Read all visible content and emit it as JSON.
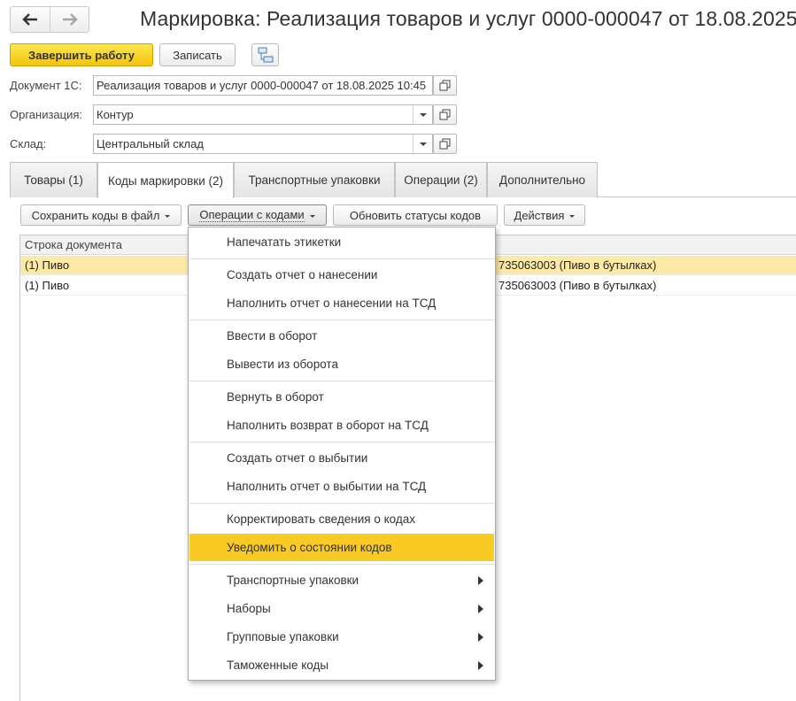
{
  "window": {
    "title": "Маркировка: Реализация товаров и услуг 0000-000047 от 18.08.2025"
  },
  "toolbar": {
    "finish_label": "Завершить работу",
    "save_label": "Записать"
  },
  "form": {
    "document_label": "Документ 1С:",
    "document_value": "Реализация товаров и услуг 0000-000047 от 18.08.2025 10:45",
    "org_label": "Организация:",
    "org_value": "Контур",
    "warehouse_label": "Склад:",
    "warehouse_value": "Центральный склад"
  },
  "tabs": [
    {
      "label": "Товары (1)"
    },
    {
      "label": "Коды маркировки (2)"
    },
    {
      "label": "Транспортные упаковки"
    },
    {
      "label": "Операции (2)"
    },
    {
      "label": "Дополнительно"
    }
  ],
  "codes_toolbar": {
    "save_codes_label": "Сохранить коды в файл",
    "operations_label": "Операции с кодами",
    "refresh_label": "Обновить статусы кодов",
    "actions_label": "Действия"
  },
  "grid": {
    "column_header": "Строка документа",
    "rows": [
      {
        "line": "(1) Пиво",
        "product": "735063003 (Пиво в бутылках)",
        "selected": true
      },
      {
        "line": "(1) Пиво",
        "product": "735063003 (Пиво в бутылках)",
        "selected": false
      }
    ]
  },
  "menu": {
    "items": [
      {
        "label": "Напечатать этикетки"
      },
      {
        "label": "Создать отчет о нанесении"
      },
      {
        "label": "Наполнить отчет о нанесении на ТСД"
      },
      {
        "label": "Ввести в оборот"
      },
      {
        "label": "Вывести из оборота"
      },
      {
        "label": "Вернуть в оборот"
      },
      {
        "label": "Наполнить возврат в оборот на ТСД"
      },
      {
        "label": "Создать отчет о выбытии"
      },
      {
        "label": "Наполнить отчет о выбытии на ТСД"
      },
      {
        "label": "Корректировать сведения о кодах"
      },
      {
        "label": "Уведомить о состоянии кодов",
        "highlighted": true
      },
      {
        "label": "Транспортные упаковки",
        "submenu": true
      },
      {
        "label": "Наборы",
        "submenu": true
      },
      {
        "label": "Групповые упаковки",
        "submenu": true
      },
      {
        "label": "Таможенные коды",
        "submenu": true
      }
    ]
  },
  "colors": {
    "accent_yellow": "#f9ca24",
    "selected_row": "#fbeaa6"
  },
  "icons": [
    "back-arrow-icon",
    "forward-arrow-icon",
    "structure-icon",
    "open-icon",
    "dropdown-icon",
    "submenu-arrow-icon"
  ]
}
